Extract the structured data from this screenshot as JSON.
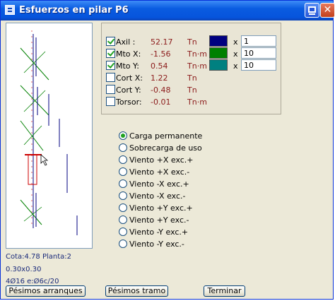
{
  "window": {
    "title": "Esfuerzos en pilar P6"
  },
  "forces": [
    {
      "label": "Axil  :",
      "checked": true,
      "value": "52.17",
      "unit": "Tn",
      "color": "#000080",
      "scale": "1"
    },
    {
      "label": "Mto X:",
      "checked": true,
      "value": "-1.56",
      "unit": "Tn·m",
      "color": "#008000",
      "scale": "10"
    },
    {
      "label": "Mto Y:",
      "checked": true,
      "value": "0.54",
      "unit": "Tn·m",
      "color": "#008080",
      "scale": "10"
    },
    {
      "label": "Cort X:",
      "checked": false,
      "value": "1.22",
      "unit": "Tn"
    },
    {
      "label": "Cort Y:",
      "checked": false,
      "value": "-0.48",
      "unit": "Tn"
    },
    {
      "label": "Torsor:",
      "checked": false,
      "value": "-0.01",
      "unit": "Tn·m"
    }
  ],
  "x_symbol": "x",
  "load_cases": [
    {
      "label": "Carga permanente",
      "selected": true
    },
    {
      "label": "Sobrecarga de uso",
      "selected": false
    },
    {
      "label": "Viento +X exc.+",
      "selected": false
    },
    {
      "label": "Viento +X exc.-",
      "selected": false
    },
    {
      "label": "Viento -X exc.+",
      "selected": false
    },
    {
      "label": "Viento -X exc.-",
      "selected": false
    },
    {
      "label": "Viento +Y exc.+",
      "selected": false
    },
    {
      "label": "Viento +Y exc.-",
      "selected": false
    },
    {
      "label": "Viento -Y exc.+",
      "selected": false
    },
    {
      "label": "Viento -Y exc.-",
      "selected": false
    }
  ],
  "info": {
    "cota": "Cota:4.78 Planta:2",
    "section": "0.30x0.30",
    "reinforcement": "4Ø16 e:Ø6c/20"
  },
  "buttons": {
    "worst_ends": "Pésimos arranques",
    "worst_span": "Pésimos tramo",
    "finish": "Terminar"
  }
}
